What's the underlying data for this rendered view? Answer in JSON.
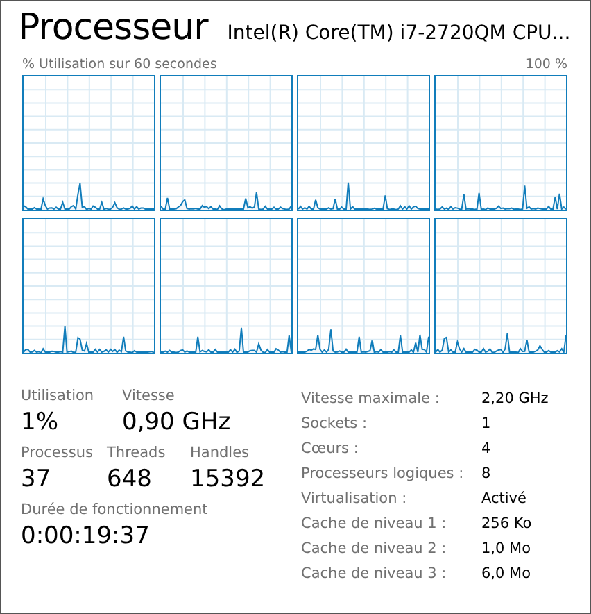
{
  "title": "Processeur",
  "model": "Intel(R) Core(TM) i7-2720QM CPU...",
  "graph_caption": "% Utilisation sur 60 secondes",
  "graph_max": "100 %",
  "graphs": [
    {
      "kind": "graph"
    },
    {
      "kind": "graph"
    },
    {
      "kind": "graph"
    },
    {
      "kind": "graph"
    },
    {
      "kind": "graph"
    },
    {
      "kind": "graph"
    },
    {
      "kind": "graph"
    },
    {
      "kind": "graph"
    }
  ],
  "stats": [
    [
      {
        "label": "Utilisation",
        "value": "1%"
      },
      {
        "label": "Vitesse",
        "value": "0,90 GHz"
      }
    ],
    [
      {
        "label": "Processus",
        "value": "37"
      },
      {
        "label": "Threads",
        "value": "648"
      },
      {
        "label": "Handles",
        "value": "15392"
      }
    ],
    [
      {
        "label": "Durée de fonctionnement",
        "value": "0:00:19:37"
      }
    ]
  ],
  "details": [
    {
      "label": "Vitesse maximale :",
      "value": "2,20 GHz"
    },
    {
      "label": "Sockets :",
      "value": "1"
    },
    {
      "label": "Cœurs :",
      "value": "4"
    },
    {
      "label": "Processeurs logiques :",
      "value": "8"
    },
    {
      "label": "Virtualisation :",
      "value": "Activé"
    },
    {
      "label": "Cache de niveau 1 :",
      "value": "256 Ko"
    },
    {
      "label": "Cache de niveau 2 :",
      "value": "1,0 Mo"
    },
    {
      "label": "Cache de niveau 3 :",
      "value": "6,0 Mo"
    }
  ]
}
